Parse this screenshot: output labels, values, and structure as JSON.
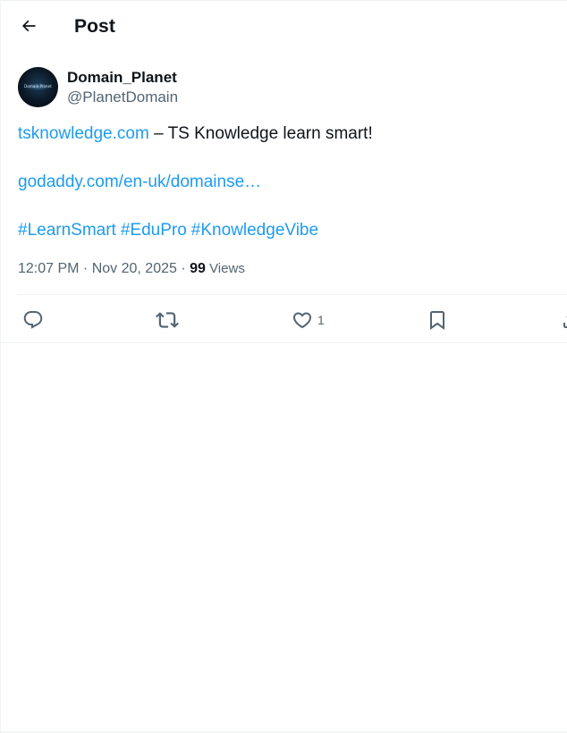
{
  "header": {
    "back_icon": "arrow-left-icon",
    "title": "Post"
  },
  "author": {
    "avatar_text": "Domain Planet",
    "display_name": "Domain_Planet",
    "handle": "@PlanetDomain"
  },
  "post": {
    "link1": "tsknowledge.com",
    "line1_rest": " – TS Knowledge learn smart!",
    "link2": "godaddy.com/en-uk/domainse…",
    "hashtags": [
      "#LearnSmart",
      "#EduPro",
      "#KnowledgeVibe"
    ]
  },
  "meta": {
    "time": "12:07 PM",
    "separator1": " · ",
    "date": "Nov 20, 2025",
    "separator2": " · ",
    "views_count": "99",
    "views_label": " Views"
  },
  "actions": {
    "reply_icon": "reply-icon",
    "repost_icon": "repost-icon",
    "like_icon": "heart-icon",
    "like_count": "1",
    "bookmark_icon": "bookmark-icon",
    "share_icon": "share-icon"
  },
  "colors": {
    "accent": "#1d9bf0",
    "text": "#0f1419",
    "muted": "#536471",
    "border": "#eff3f4"
  }
}
